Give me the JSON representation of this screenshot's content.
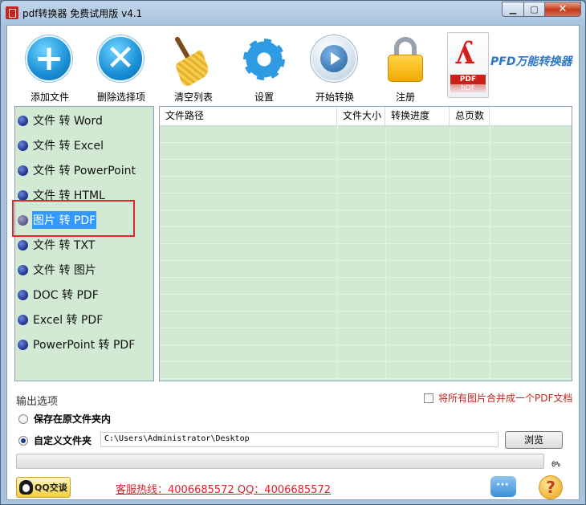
{
  "window": {
    "title": "pdf转换器 免费试用版 v4.1"
  },
  "toolbar": {
    "add_file": "添加文件",
    "delete_selected": "删除选择项",
    "clear_list": "清空列表",
    "settings": "设置",
    "start_convert": "开始转换",
    "register": "注册",
    "brand": "PFD万能转换器",
    "pdf_band": "PDF",
    "pdf_band2": "bDF"
  },
  "conversions": [
    {
      "label": "文件 转 Word"
    },
    {
      "label": "文件 转 Excel"
    },
    {
      "label": "文件 转 PowerPoint"
    },
    {
      "label": "文件 转 HTML"
    },
    {
      "label": "图片 转 PDF",
      "selected": true
    },
    {
      "label": "文件 转 TXT"
    },
    {
      "label": "文件 转 图片"
    },
    {
      "label": "DOC 转 PDF"
    },
    {
      "label": "Excel 转 PDF"
    },
    {
      "label": "PowerPoint 转 PDF"
    }
  ],
  "file_table": {
    "columns": [
      "文件路径",
      "文件大小",
      "转换进度",
      "总页数"
    ],
    "rows": []
  },
  "output": {
    "title": "输出选项",
    "merge_label": "将所有图片合并成一个PDF文档",
    "merge_checked": false,
    "keep_original_label": "保存在原文件夹内",
    "custom_folder_label": "自定义文件夹",
    "selected_option": "custom",
    "path_value": "C:\\Users\\Administrator\\Desktop",
    "browse_label": "浏览"
  },
  "progress": {
    "value": 0,
    "text": "0%"
  },
  "footer": {
    "qq_label": "QQ交谈",
    "hotline": "客服热线：4006685572 QQ：4006685572"
  },
  "colors": {
    "panel_green": "#d2ead4",
    "selection_blue": "#3399ff",
    "hotline_red": "#d52428",
    "highlight_red": "#e3262a"
  }
}
